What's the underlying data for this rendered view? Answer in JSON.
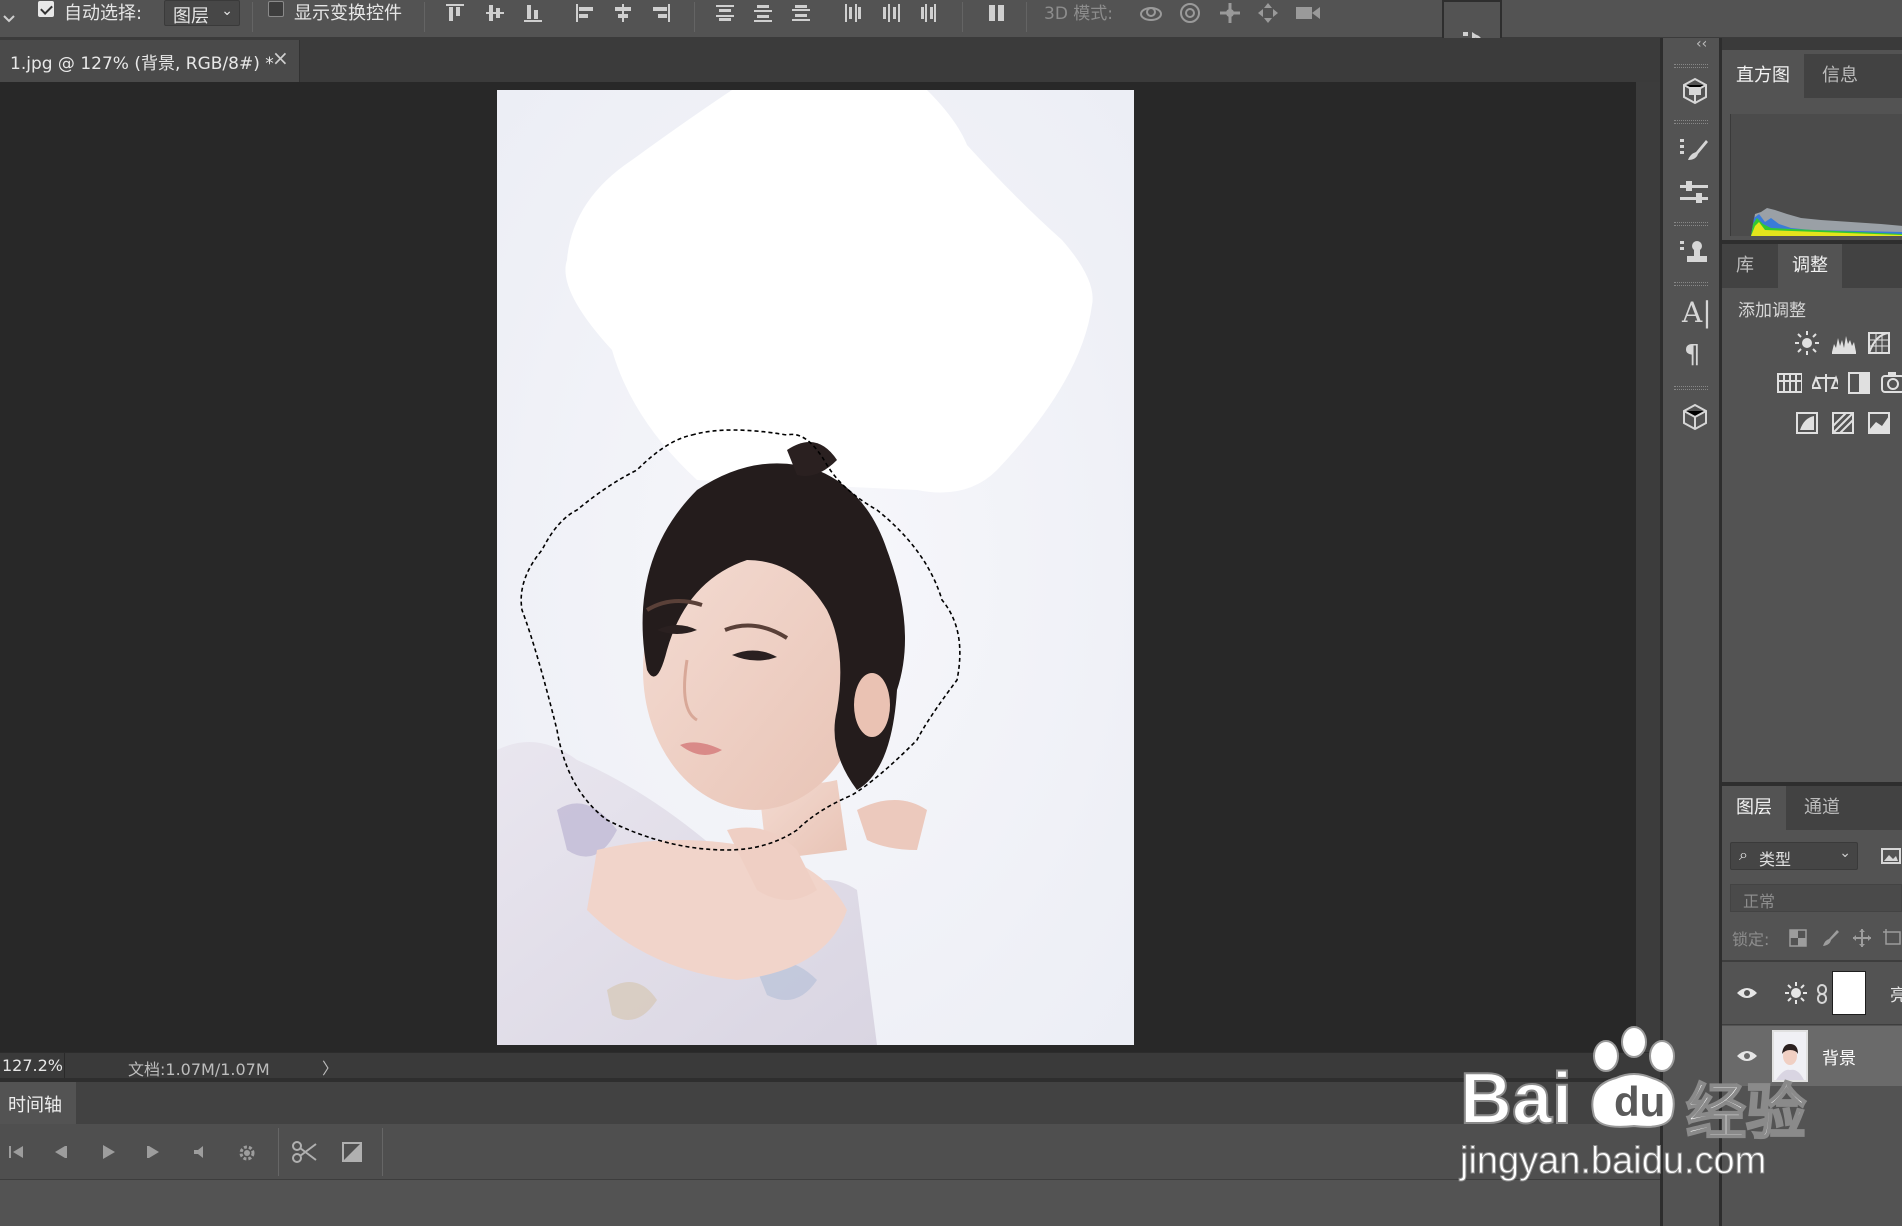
{
  "options_bar": {
    "auto_select_label": "自动选择:",
    "auto_select_checked": true,
    "auto_select_target": "图层",
    "show_transform_label": "显示变换控件",
    "show_transform_checked": false,
    "mode_3d_label": "3D 模式:"
  },
  "document_tab": {
    "title": "1.jpg @ 127% (背景, RGB/8#) *",
    "close_glyph": "×"
  },
  "status_bar": {
    "zoom": "127.2%",
    "doc_size": "文档:1.07M/1.07M",
    "arrow_glyph": "〉"
  },
  "timeline": {
    "tab_label": "时间轴"
  },
  "collapse_glyph": "‹‹",
  "histogram_panel": {
    "tabs": [
      "直方图",
      "信息"
    ],
    "active_tab": 0
  },
  "adjustments_panel": {
    "tabs": [
      "库",
      "调整"
    ],
    "active_tab": 1,
    "add_adjustment_label": "添加调整"
  },
  "layers_panel": {
    "tabs": [
      "图层",
      "通道"
    ],
    "active_tab": 0,
    "filter_label": "类型",
    "blend_mode": "正常",
    "lock_label": "锁定:",
    "layers": [
      {
        "name": "亮",
        "type": "adjustment",
        "icon": "brightness-icon",
        "visible": true
      },
      {
        "name": "背景",
        "type": "image",
        "visible": true,
        "selected": true
      }
    ]
  },
  "watermark": {
    "brand": "Bai",
    "brand_tail": "du",
    "product": "经验",
    "url": "jingyan.baidu.com"
  },
  "colors": {
    "panel": "#535353",
    "canvas_bg": "#282828",
    "selection": "#000000"
  }
}
